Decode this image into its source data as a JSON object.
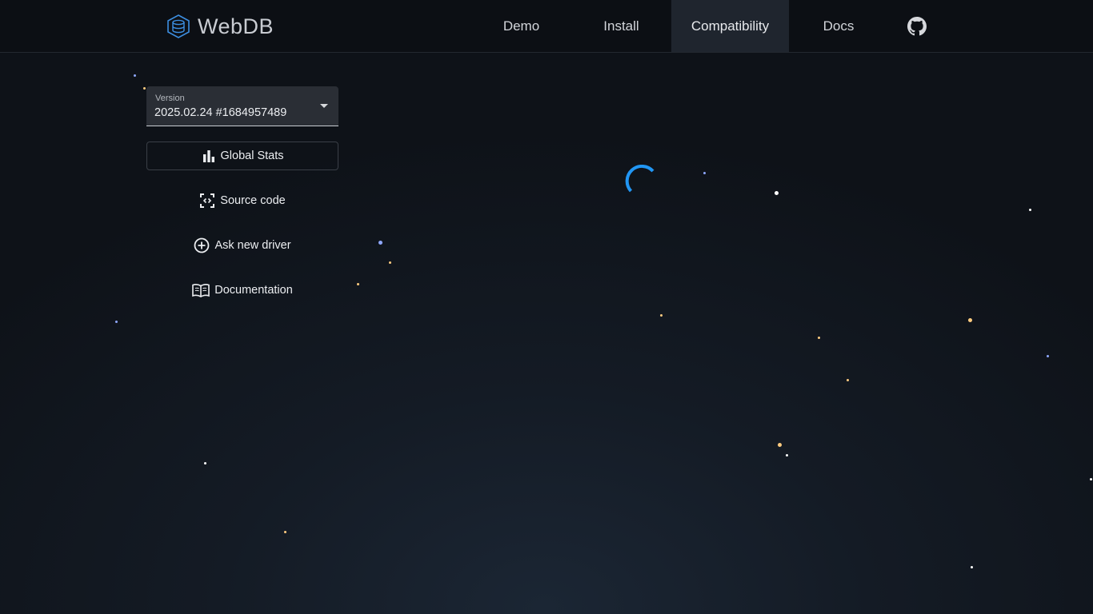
{
  "header": {
    "brand": "WebDB",
    "nav": [
      {
        "label": "Demo",
        "active": false
      },
      {
        "label": "Install",
        "active": false
      },
      {
        "label": "Compatibility",
        "active": true
      },
      {
        "label": "Docs",
        "active": false
      }
    ],
    "github_icon": "github-icon"
  },
  "sidebar": {
    "version": {
      "label": "Version",
      "value": "2025.02.24 #1684957489"
    },
    "buttons": [
      {
        "label": "Global Stats",
        "icon": "bar-chart-icon"
      },
      {
        "label": "Source code",
        "icon": "code-scan-icon"
      },
      {
        "label": "Ask new driver",
        "icon": "plus-circle-icon"
      },
      {
        "label": "Documentation",
        "icon": "book-icon"
      }
    ]
  },
  "colors": {
    "accent": "#2196f3",
    "star_white": "#ffffff",
    "star_orange": "#ffcc80",
    "star_blue": "#8fa8ff"
  }
}
